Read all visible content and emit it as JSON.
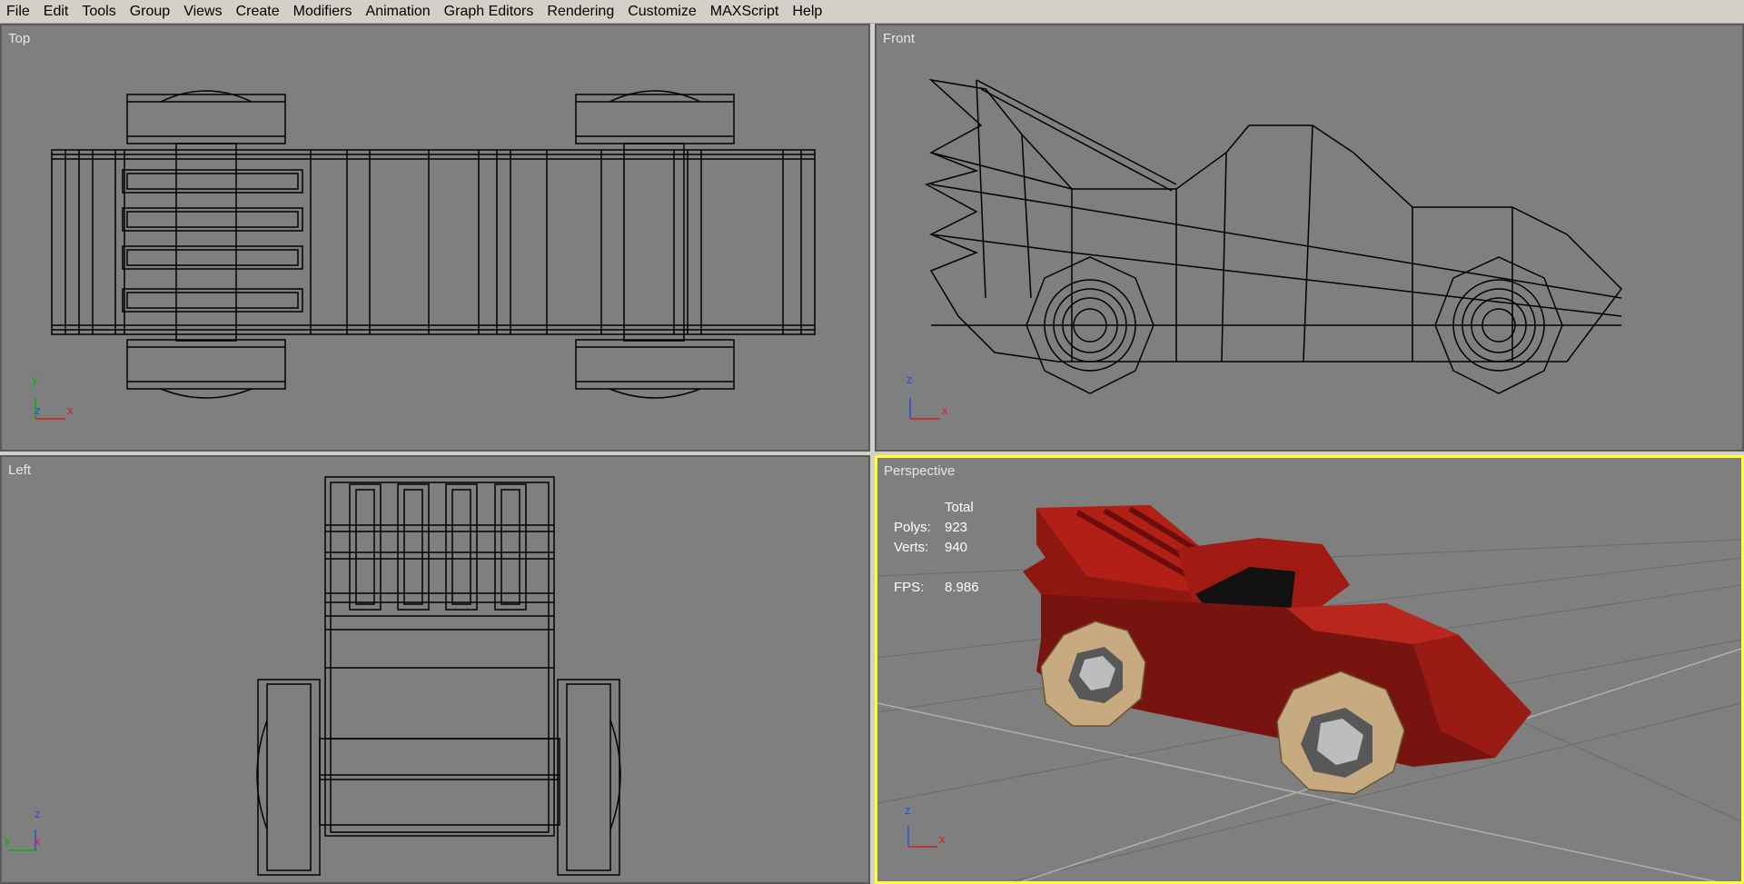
{
  "menu": [
    "File",
    "Edit",
    "Tools",
    "Group",
    "Views",
    "Create",
    "Modifiers",
    "Animation",
    "Graph Editors",
    "Rendering",
    "Customize",
    "MAXScript",
    "Help"
  ],
  "viewports": {
    "top": {
      "label": "Top",
      "axis1": "y",
      "axis2": "x",
      "axis3": "z"
    },
    "front": {
      "label": "Front",
      "axis1": "z",
      "axis2": "x"
    },
    "left": {
      "label": "Left",
      "axis1": "z",
      "axis2": "y",
      "axis3": "x"
    },
    "perspective": {
      "label": "Perspective",
      "axis1": "z",
      "axis2": "x"
    }
  },
  "stats": {
    "header": "Total",
    "polys_label": "Polys:",
    "polys_value": "923",
    "verts_label": "Verts:",
    "verts_value": "940",
    "fps_label": "FPS:",
    "fps_value": "8.986"
  },
  "colors": {
    "viewport_bg": "#7f7f7f",
    "active_border": "#ffff33",
    "wire": "#000000",
    "car_red": "#a01a14",
    "wheel_wood": "#c8aa80"
  }
}
